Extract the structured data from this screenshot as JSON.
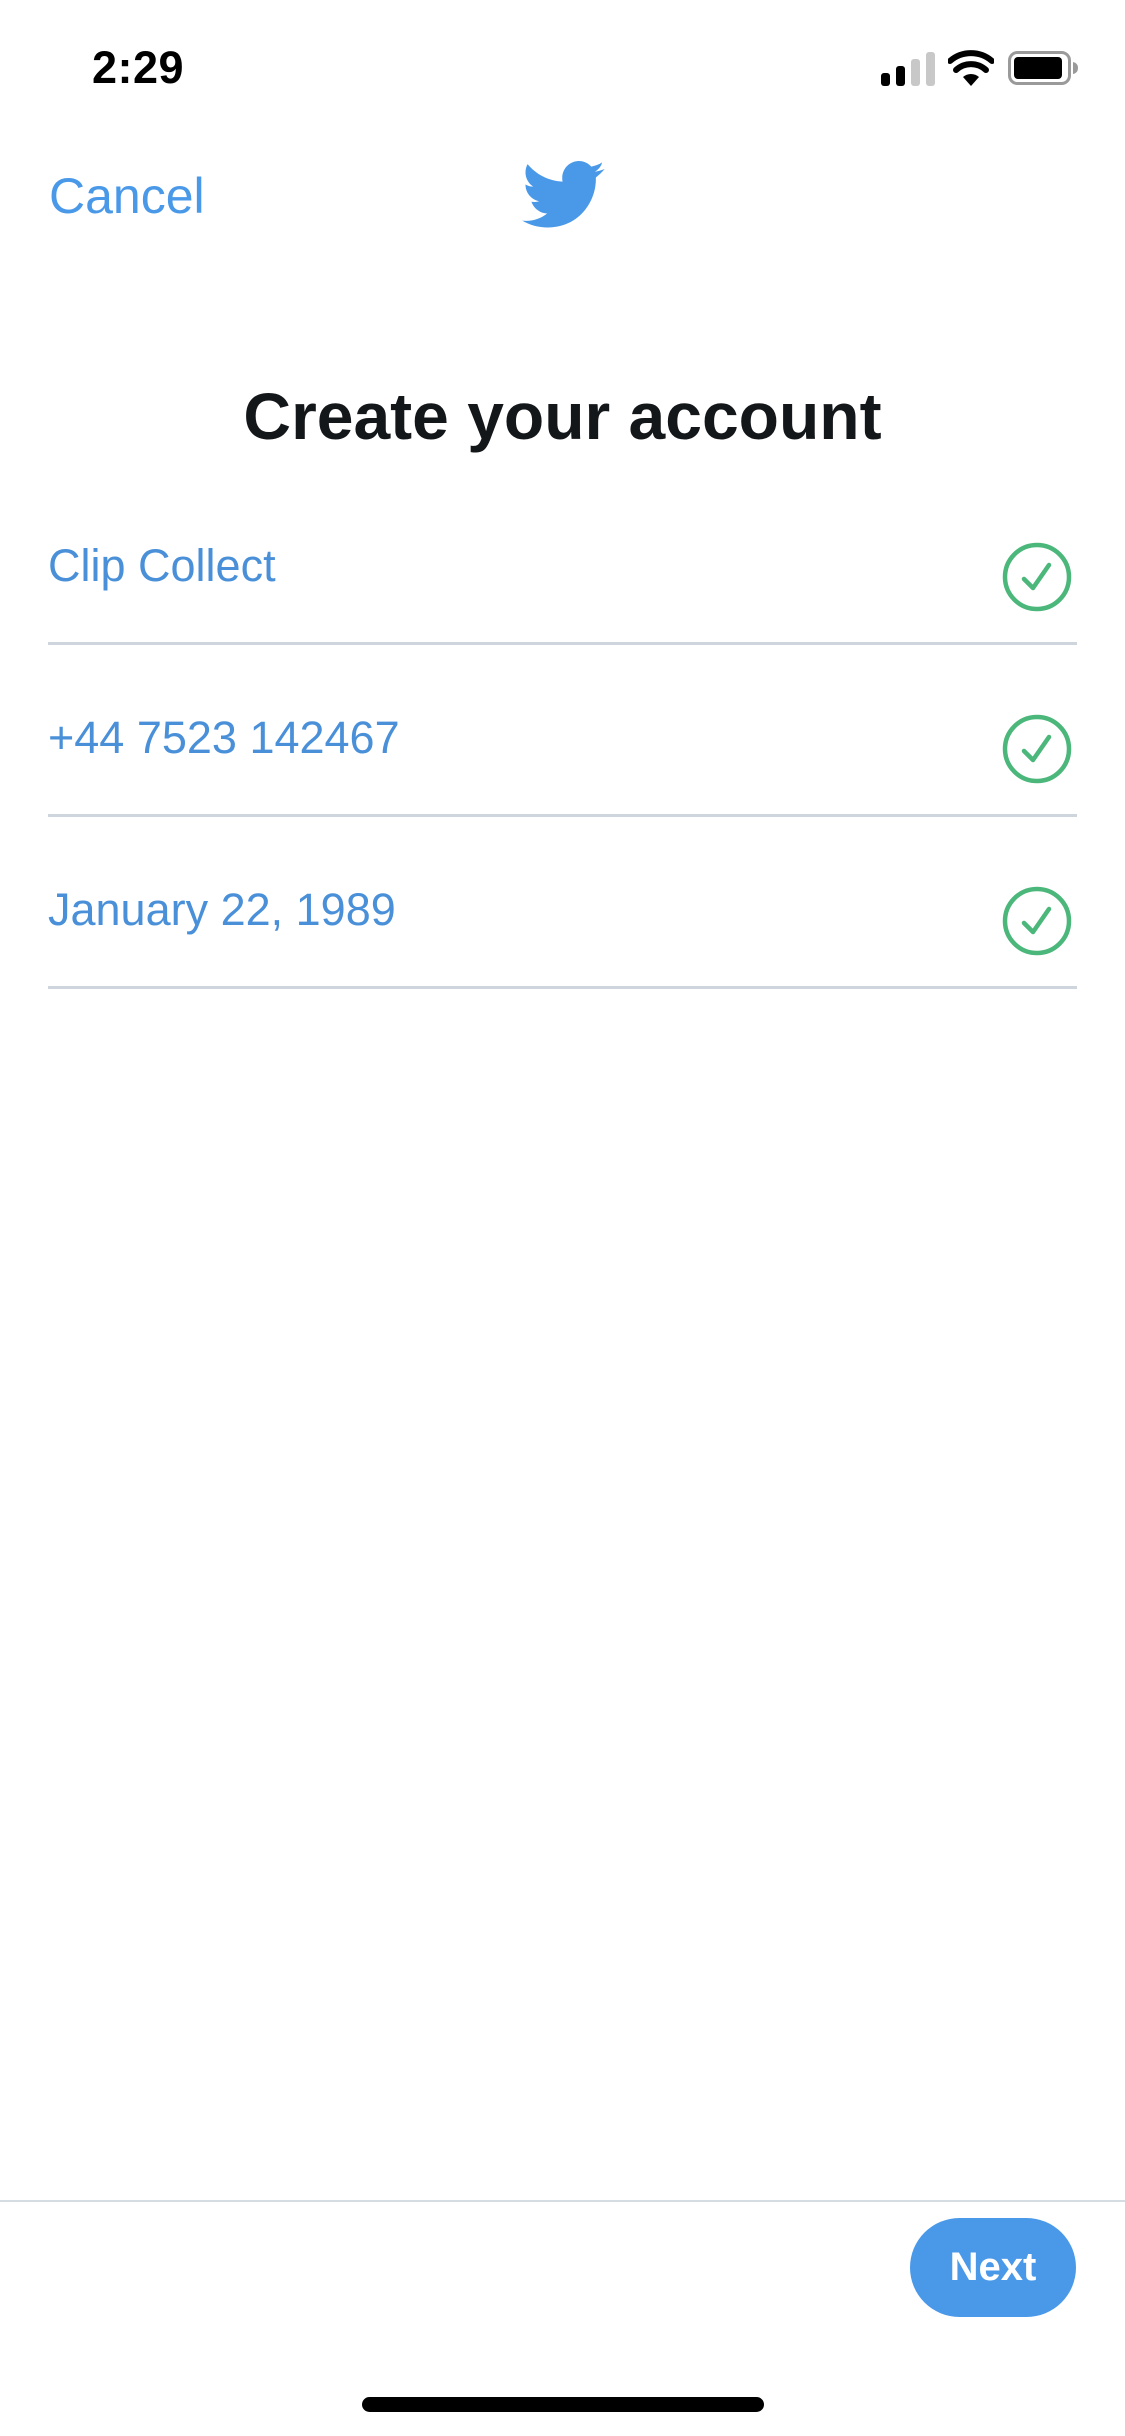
{
  "status_bar": {
    "time": "2:29",
    "signal_bars_active": 2,
    "signal_bars_total": 4,
    "wifi_icon": "wifi-icon",
    "battery_icon": "battery-icon"
  },
  "nav": {
    "cancel_label": "Cancel",
    "logo_icon": "twitter-bird-icon"
  },
  "page": {
    "title": "Create your account"
  },
  "fields": [
    {
      "name": "name",
      "value": "Clip Collect",
      "status": "valid",
      "status_icon": "check-circle-icon"
    },
    {
      "name": "phone",
      "value": "+44 7523 142467",
      "status": "valid",
      "status_icon": "check-circle-icon"
    },
    {
      "name": "date-of-birth",
      "value": "January 22, 1989",
      "status": "valid",
      "status_icon": "check-circle-icon"
    }
  ],
  "footer": {
    "next_label": "Next"
  },
  "colors": {
    "accent": "#4A99E9",
    "field_text": "#4A90D9",
    "valid": "#4BB77A",
    "title": "#14171A",
    "divider": "#CED5DC"
  }
}
